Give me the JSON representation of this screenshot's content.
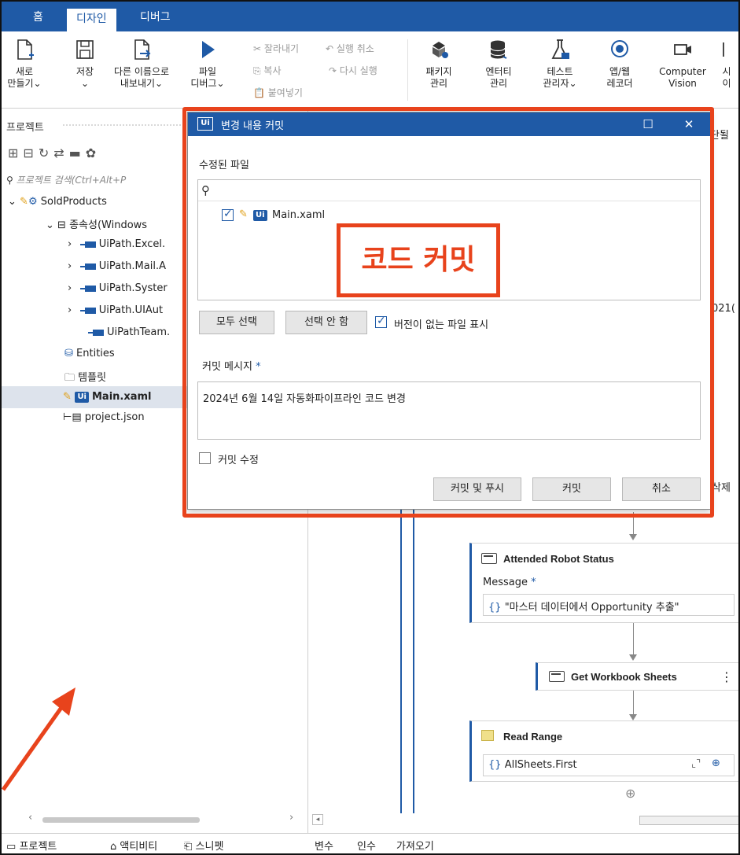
{
  "tabs": [
    {
      "label": "홈"
    },
    {
      "label": "디자인"
    },
    {
      "label": "디버그"
    }
  ],
  "ribbon": {
    "new_label_1": "새로",
    "new_label_2": "만들기⌄",
    "save_label_1": "저장",
    "save_label_2": "⌄",
    "export_label_1": "다른 이름으로",
    "export_label_2": "내보내기⌄",
    "debug_label_1": "파일",
    "debug_label_2": "디버그⌄",
    "cut": "잘라내기",
    "undo": "실행 취소",
    "copy": "복사",
    "redo": "다시 실행",
    "paste": "붙여넣기",
    "package_1": "패키지",
    "package_2": "관리",
    "entity_1": "엔터티",
    "entity_2": "관리",
    "test_1": "테스트",
    "test_2": "관리자⌄",
    "recorder_1": "앱/웹",
    "recorder_2": "레코더",
    "cv_1": "Computer",
    "cv_2": "Vision",
    "more_1": "시",
    "more_2": "이"
  },
  "project_panel": {
    "title": "프로젝트",
    "search_placeholder": "프로젝트 검색(Ctrl+Alt+P",
    "tree": {
      "root": "SoldProducts",
      "deps": "종속성(Windows",
      "dep1": "UiPath.Excel.",
      "dep2": "UiPath.Mail.A",
      "dep3": "UiPath.Syster",
      "dep4": "UiPath.UIAut",
      "dep5": "UiPathTeam.",
      "entities": "Entities",
      "templates": "템플릿",
      "main": "Main.xaml",
      "project_json": "project.json"
    }
  },
  "bottom_left_tabs": {
    "project": "프로젝트",
    "activities": "액티비티",
    "snippets": "스니펫"
  },
  "bottom_right_tabs": {
    "variables": "변수",
    "arguments": "인수",
    "imports": "가져오기"
  },
  "right_edge": {
    "t1": "단될",
    "t2": "021(",
    "t3": "삭제"
  },
  "workflow": {
    "attended": {
      "title": "Attended Robot Status",
      "field_label": "Message",
      "required": "*",
      "value": "\"마스터 데이터에서 Opportunity 추출\""
    },
    "workbook": {
      "title": "Get Workbook Sheets",
      "menu": "⋮"
    },
    "read_range": {
      "title": "Read Range",
      "value": "AllSheets.First"
    },
    "brace": "{}"
  },
  "dialog": {
    "title": "변경 내용 커밋",
    "modified_files_label": "수정된 파일",
    "file_name": "Main.xaml",
    "select_all": "모두 선택",
    "select_none": "선택 안 함",
    "show_unversioned": "버전이 없는 파일 표시",
    "commit_message_label": "커밋 메시지",
    "required_mark": "*",
    "commit_message": "2024년 6월 14일 자동화파이프라인 코드 변경",
    "amend_commit": "커밋 수정",
    "commit_and_push": "커밋 및 푸시",
    "commit": "커밋",
    "cancel": "취소",
    "logo": "Ui"
  },
  "annotation": {
    "callout_text": "코드 커밋",
    "color": "#e8431c"
  },
  "colors": {
    "accent": "#1f5aa6"
  }
}
